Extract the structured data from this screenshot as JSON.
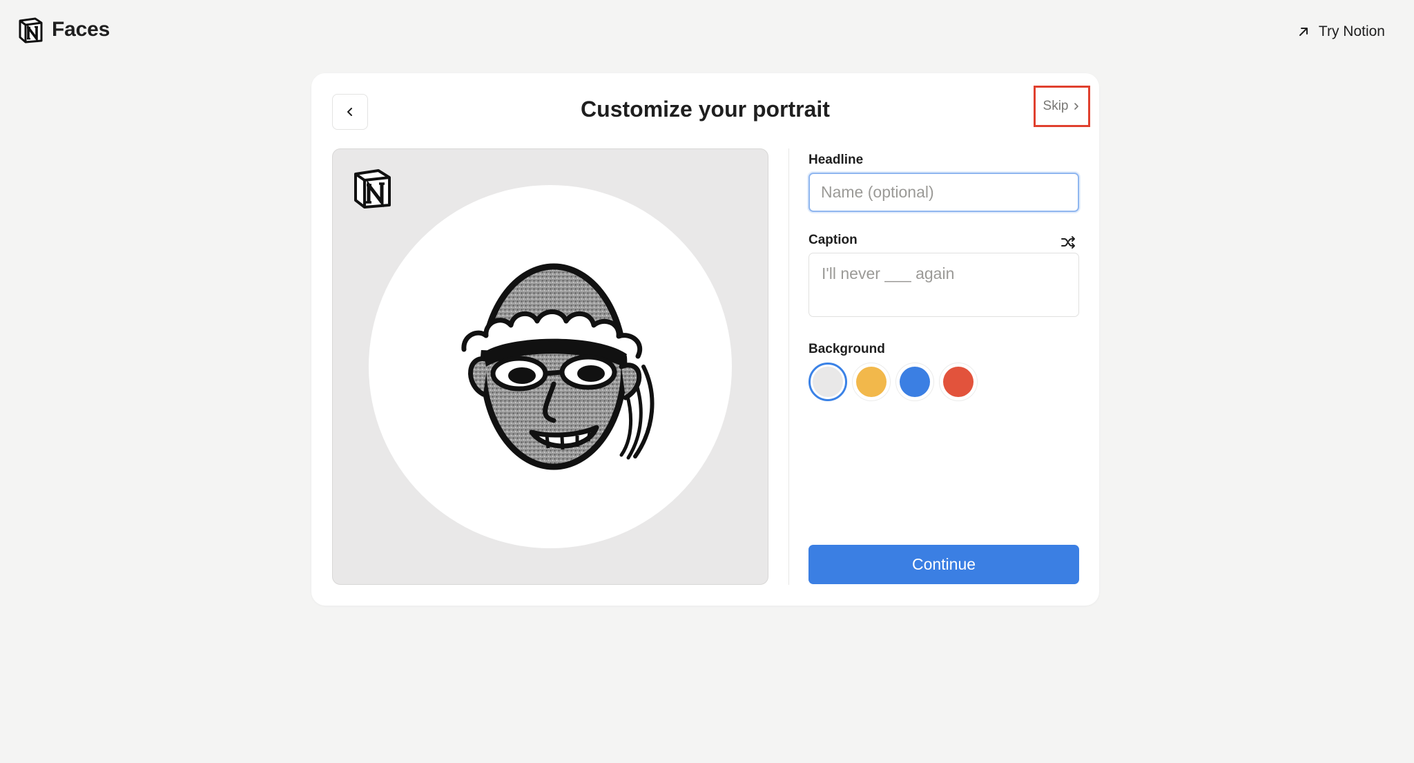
{
  "app": {
    "brand_name": "Faces",
    "try_link_label": "Try Notion"
  },
  "card": {
    "title": "Customize your portrait",
    "skip_label": "Skip"
  },
  "form": {
    "headline_label": "Headline",
    "headline_placeholder": "Name (optional)",
    "headline_value": "",
    "caption_label": "Caption",
    "caption_placeholder": "I'll never ___ again",
    "caption_value": "",
    "background_label": "Background",
    "background_options": [
      {
        "name": "light-gray",
        "color": "#e9e8e8",
        "selected": true
      },
      {
        "name": "yellow",
        "color": "#f2b84b",
        "selected": false
      },
      {
        "name": "blue",
        "color": "#3b7fe3",
        "selected": false
      },
      {
        "name": "red",
        "color": "#e2533c",
        "selected": false
      }
    ],
    "continue_label": "Continue"
  },
  "colors": {
    "page_bg": "#f4f4f3",
    "accent": "#3b7fe3",
    "highlight": "#e0402e"
  },
  "icons": {
    "brand": "notion-logo-icon",
    "try": "arrow-up-right-icon",
    "back": "chevron-left-icon",
    "skip": "chevron-right-icon",
    "shuffle": "shuffle-icon",
    "badge": "notion-logo-icon"
  }
}
